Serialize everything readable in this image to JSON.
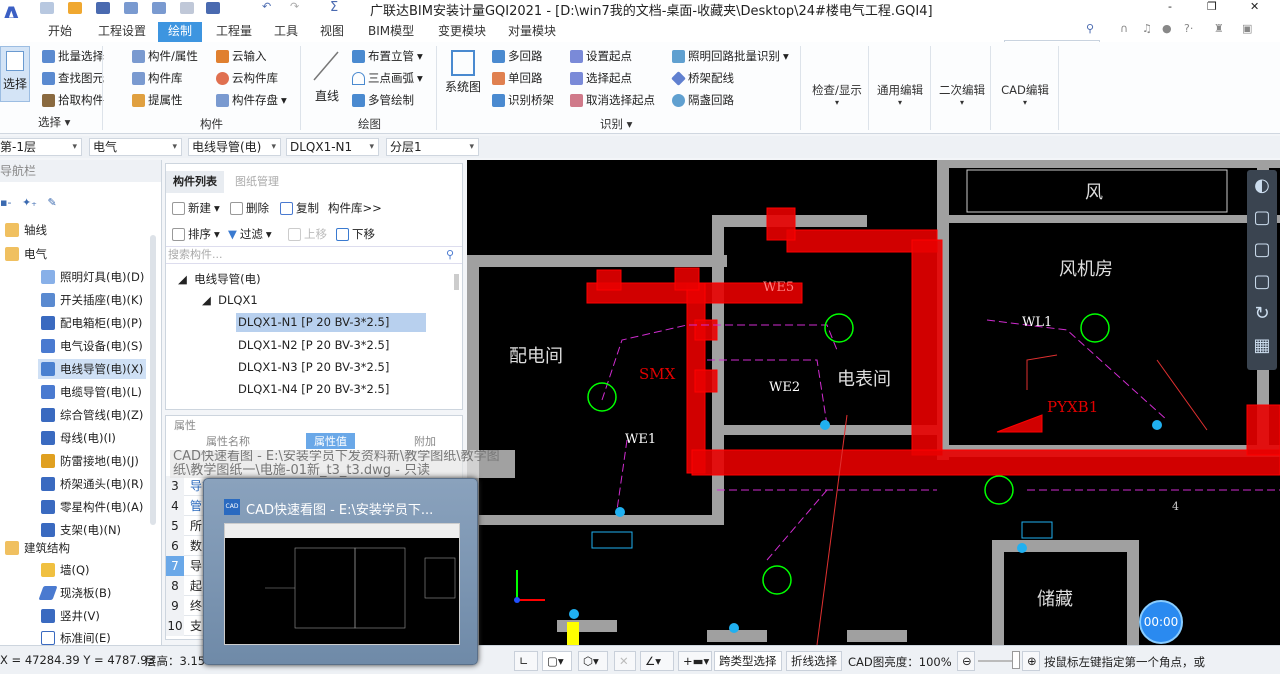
{
  "title": "广联达BIM安装计量GQI2021 - [D:\\win7我的文档-桌面-收藏夹\\Desktop\\24#楼电气工程.GQI4]",
  "window_controls": {
    "minimize": "-",
    "restore": "❐",
    "close": "✕"
  },
  "tabs": [
    "开始",
    "工程设置",
    "绘制",
    "工程量",
    "工具",
    "视图",
    "BIM模型",
    "变更模块",
    "对量模块"
  ],
  "active_tab": "绘制",
  "search_placeholder": "搜索",
  "ribbon": {
    "select": {
      "big": "选择",
      "items": [
        "批量选择",
        "查找图元",
        "拾取构件"
      ],
      "group": "选择"
    },
    "component": {
      "items": [
        "构件/属性",
        "构件库",
        "提属性",
        "云输入",
        "云构件库",
        "构件存盘"
      ],
      "group": "构件"
    },
    "draw": {
      "big": "直线",
      "items": [
        "布置立管",
        "三点画弧",
        "多管绘制"
      ],
      "group": "绘图"
    },
    "identify": {
      "big": "系统图",
      "items": [
        "多回路",
        "单回路",
        "识别桥架",
        "设置起点",
        "选择起点",
        "取消选择起点",
        "照明回路批量识别",
        "桥架配线",
        "隔盏回路"
      ],
      "group": "识别"
    },
    "dropdowns": [
      "检查/显示",
      "通用编辑",
      "二次编辑",
      "CAD编辑"
    ]
  },
  "selectors": [
    "第-1层",
    "电气",
    "电线导管(电)",
    "DLQX1-N1",
    "分层1"
  ],
  "nav": {
    "title": "导航栏",
    "categories": [
      "轴线",
      "电气",
      "建筑结构"
    ],
    "items": [
      "照明灯具(电)(D)",
      "开关插座(电)(K)",
      "配电箱柜(电)(P)",
      "电气设备(电)(S)",
      "电线导管(电)(X)",
      "电缆导管(电)(L)",
      "综合管线(电)(Z)",
      "母线(电)(I)",
      "防雷接地(电)(J)",
      "桥架通头(电)(R)",
      "零星构件(电)(A)",
      "支架(电)(N)"
    ],
    "struct_items": [
      "墙(Q)",
      "现浇板(B)",
      "竖井(V)",
      "标准间(E)"
    ],
    "selected": "电线导管(电)(X)"
  },
  "component_list": {
    "tabs": [
      "构件列表",
      "图纸管理"
    ],
    "toolbar": [
      "新建",
      "删除",
      "复制",
      "构件库>>"
    ],
    "toolbar2": [
      "排序",
      "过滤",
      "上移",
      "下移"
    ],
    "search_placeholder": "搜索构件...",
    "tree": {
      "root": "电线导管(电)",
      "group": "DLQX1",
      "items": [
        "DLQX1-N1 [P 20 BV-3*2.5]",
        "DLQX1-N2 [P 20 BV-3*2.5]",
        "DLQX1-N3 [P 20 BV-3*2.5]",
        "DLQX1-N4 [P 20 BV-3*2.5]"
      ]
    }
  },
  "properties": {
    "title": "属性",
    "header": [
      "属性名称",
      "属性值",
      "附加"
    ],
    "rows": [
      {
        "n": "3",
        "t": "导管材质"
      },
      {
        "n": "4",
        "t": "管"
      },
      {
        "n": "5",
        "t": "所"
      },
      {
        "n": "6",
        "t": "数"
      },
      {
        "n": "7",
        "t": "导"
      },
      {
        "n": "8",
        "t": "起"
      },
      {
        "n": "9",
        "t": "终"
      },
      {
        "n": "10",
        "t": "支"
      }
    ]
  },
  "tooltip": "CAD快速看图 - E:\\安装学员下发资料新\\教学图纸\\教学图纸\\教学图纸一\\电施-01新_t3_t3.dwg - 只读",
  "thumbnail_title": "CAD快速看图 - E:\\安装学员下...",
  "cad_labels": [
    "风",
    "风机房",
    "配电间",
    "电表间",
    "储藏",
    "WL1",
    "PYXB1",
    "SMX",
    "WE5",
    "WE2",
    "WE1",
    "4"
  ],
  "timer": "00:00",
  "status": {
    "coords": "X = 47284.39 Y = 4787.93",
    "floor_height": "层高：3.15",
    "buttons": [
      "跨类型选择",
      "折线选择"
    ],
    "brightness": "CAD图亮度：100%",
    "hint": "按鼠标左键指定第一个角点，或"
  },
  "colors": {
    "accent": "#3d95e0",
    "conduit": "#ff0000",
    "wall": "#a0a0a0",
    "magenta": "#d02cd0"
  }
}
